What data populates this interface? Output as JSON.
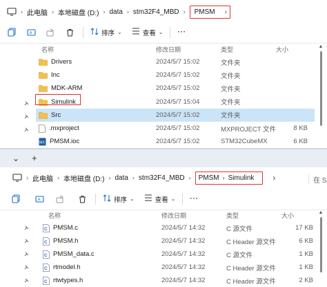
{
  "window1": {
    "breadcrumb": [
      "此电脑",
      "本地磁盘 (D:)",
      "data",
      "stm32F4_MBD"
    ],
    "current": "PMSM",
    "toolbar": {
      "sort_label": "排序",
      "view_label": "查看",
      "more_label": "···"
    },
    "columns": {
      "name": "名称",
      "date": "修改日期",
      "type": "类型",
      "size": "大小"
    },
    "rows": [
      {
        "name": "Drivers",
        "date": "2024/5/7 15:02",
        "type": "文件夹",
        "size": "",
        "icon": "folder-icon"
      },
      {
        "name": "Inc",
        "date": "2024/5/7 15:02",
        "type": "文件夹",
        "size": "",
        "icon": "folder-icon"
      },
      {
        "name": "MDK-ARM",
        "date": "2024/5/7 15:02",
        "type": "文件夹",
        "size": "",
        "icon": "folder-icon"
      },
      {
        "name": "Simulink",
        "date": "2024/5/7 15:04",
        "type": "文件夹",
        "size": "",
        "icon": "folder-icon"
      },
      {
        "name": "Src",
        "date": "2024/5/7 15:02",
        "type": "文件夹",
        "size": "",
        "icon": "folder-icon"
      },
      {
        "name": ".mxproject",
        "date": "2024/5/7 15:02",
        "type": "MXPROJECT 文件",
        "size": "8 KB",
        "icon": "file-icon"
      },
      {
        "name": "PMSM.ioc",
        "date": "2024/5/7 15:02",
        "type": "STM32CubeMX",
        "size": "6 KB",
        "icon": "ioc-file-icon"
      }
    ]
  },
  "window2": {
    "new_tab": "+",
    "breadcrumb": [
      "此电脑",
      "本地磁盘 (D:)",
      "data",
      "stm32F4_MBD"
    ],
    "current": [
      "PMSM",
      "Simulink"
    ],
    "search_hint": "在 S",
    "toolbar": {
      "sort_label": "排序",
      "view_label": "查看",
      "more_label": "···"
    },
    "columns": {
      "name": "名称",
      "date": "修改日期",
      "type": "类型",
      "size": "大小"
    },
    "rows": [
      {
        "name": "PMSM.c",
        "date": "2024/5/7 14:32",
        "type": "C 源文件",
        "size": "17 KB"
      },
      {
        "name": "PMSM.h",
        "date": "2024/5/7 14:32",
        "type": "C Header 源文件",
        "size": "6 KB"
      },
      {
        "name": "PMSM_data.c",
        "date": "2024/5/7 14:32",
        "type": "C 源文件",
        "size": "1 KB"
      },
      {
        "name": "rtmodel.h",
        "date": "2024/5/7 14:32",
        "type": "C Header 源文件",
        "size": "1 KB"
      },
      {
        "name": "rtwtypes.h",
        "date": "2024/5/7 14:32",
        "type": "C Header 源文件",
        "size": "2 KB"
      }
    ]
  },
  "colors": {
    "highlight": "#e03030",
    "selection": "#cce4f7",
    "folder": "#f2c04b"
  }
}
